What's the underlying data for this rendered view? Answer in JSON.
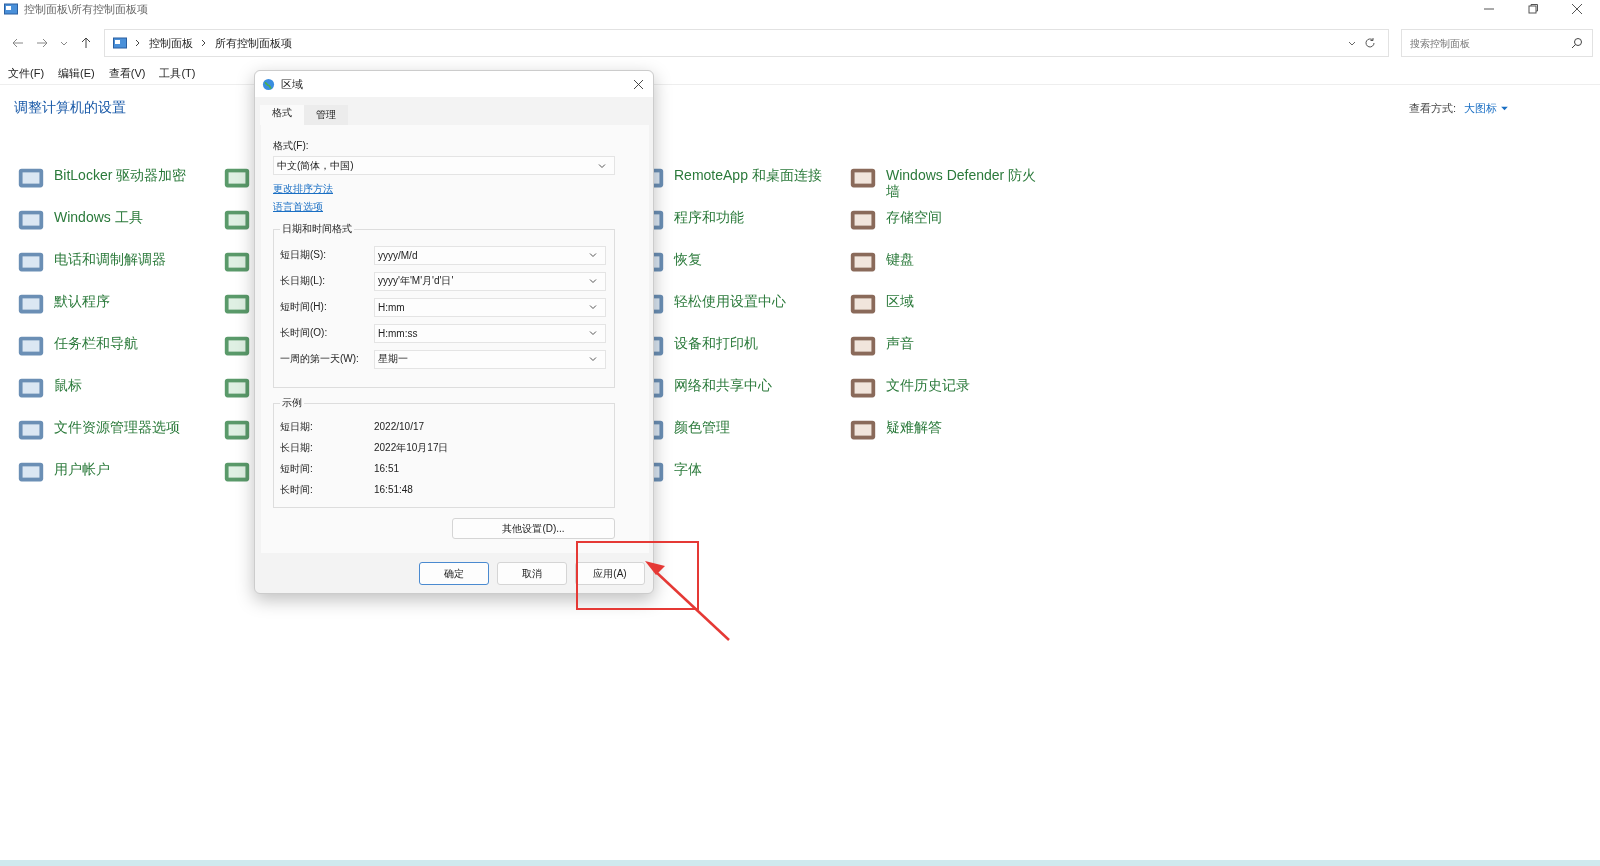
{
  "window": {
    "title": "控制面板\\所有控制面板项"
  },
  "address_bar": {
    "path": [
      "控制面板",
      "所有控制面板项"
    ]
  },
  "search": {
    "placeholder": "搜索控制面板"
  },
  "menu": [
    "文件(F)",
    "编辑(E)",
    "查看(V)",
    "工具(T)"
  ],
  "heading": "调整计算机的设置",
  "view_by": {
    "label": "查看方式:",
    "value": "大图标"
  },
  "applet_columns": [
    [
      "BitLocker 驱动器加密",
      "Windows 工具",
      "电话和调制解调器",
      "默认程序",
      "任务栏和导航",
      "鼠标",
      "文件资源管理器选项",
      "用户帐户"
    ],
    [
      "RemoteApp 和桌面连接",
      "程序和功能",
      "恢复",
      "轻松使用设置中心",
      "设备和打印机",
      "网络和共享中心",
      "颜色管理",
      "字体"
    ],
    [
      "Windows Defender 防火墙",
      "存储空间",
      "键盘",
      "区域",
      "声音",
      "文件历史记录",
      "疑难解答"
    ]
  ],
  "dialog": {
    "title": "区域",
    "tabs": [
      {
        "label": "格式",
        "selected": true
      },
      {
        "label": "管理",
        "selected": false
      }
    ],
    "format_label": "格式(F):",
    "format_value": "中文(简体，中国)",
    "links": [
      "更改排序方法",
      "语言首选项"
    ],
    "datetime_group": {
      "title": "日期和时间格式",
      "fields": [
        {
          "label": "短日期(S):",
          "value": "yyyy/M/d"
        },
        {
          "label": "长日期(L):",
          "value": "yyyy'年'M'月'd'日'"
        },
        {
          "label": "短时间(H):",
          "value": "H:mm"
        },
        {
          "label": "长时间(O):",
          "value": "H:mm:ss"
        },
        {
          "label": "一周的第一天(W):",
          "value": "星期一"
        }
      ]
    },
    "example_group": {
      "title": "示例",
      "rows": [
        {
          "label": "短日期:",
          "value": "2022/10/17"
        },
        {
          "label": "长日期:",
          "value": "2022年10月17日"
        },
        {
          "label": "短时间:",
          "value": "16:51"
        },
        {
          "label": "长时间:",
          "value": "16:51:48"
        }
      ]
    },
    "other_button": "其他设置(D)...",
    "buttons": [
      {
        "label": "确定",
        "default": true
      },
      {
        "label": "取消",
        "default": false
      },
      {
        "label": "应用(A)",
        "default": false
      }
    ]
  }
}
